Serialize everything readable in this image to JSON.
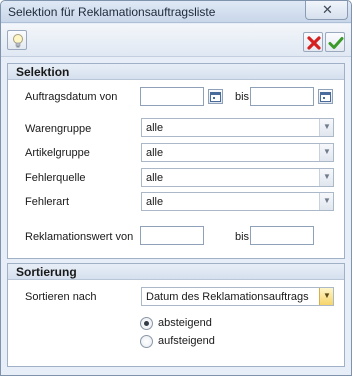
{
  "window": {
    "title": "Selektion für Reklamationsauftragsliste",
    "close_glyph": "✕"
  },
  "toolbar": {
    "hint_icon": "lightbulb-icon",
    "cancel_icon": "red-x-icon",
    "ok_icon": "green-check-icon"
  },
  "selektion": {
    "heading": "Selektion",
    "auftragsdatum": {
      "label": "Auftragsdatum von",
      "from_value": "",
      "to_label": "bis",
      "to_value": ""
    },
    "warengruppe": {
      "label": "Warengruppe",
      "value": "alle"
    },
    "artikelgruppe": {
      "label": "Artikelgruppe",
      "value": "alle"
    },
    "fehlerquelle": {
      "label": "Fehlerquelle",
      "value": "alle"
    },
    "fehlerart": {
      "label": "Fehlerart",
      "value": "alle"
    },
    "reklamationswert": {
      "label": "Reklamationswert von",
      "from_value": "",
      "to_label": "bis",
      "to_value": ""
    }
  },
  "sortierung": {
    "heading": "Sortierung",
    "sort_label": "Sortieren nach",
    "sort_value": "Datum des Reklamationsauftrags",
    "options": [
      {
        "label": "absteigend",
        "selected": true
      },
      {
        "label": "aufsteigend",
        "selected": false
      }
    ]
  },
  "colors": {
    "accent_combo": "#f6d46a",
    "cancel": "#d62020",
    "ok": "#3a9a2a"
  }
}
